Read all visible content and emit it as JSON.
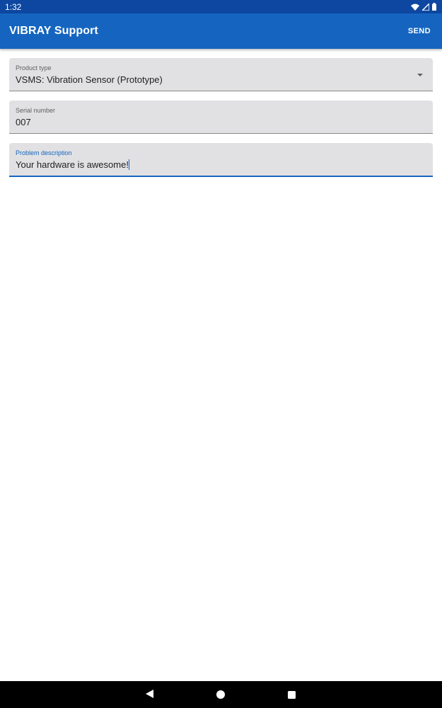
{
  "status_bar": {
    "time": "1:32",
    "icons": [
      "wifi-icon",
      "signal-icon",
      "battery-icon"
    ]
  },
  "app_bar": {
    "title": "VIBRAY Support",
    "send_label": "SEND"
  },
  "form": {
    "product_type": {
      "label": "Product type",
      "value": "VSMS: Vibration Sensor (Prototype)"
    },
    "serial_number": {
      "label": "Serial number",
      "value": "007"
    },
    "problem_description": {
      "label": "Problem description",
      "value": "Your hardware is awesome!"
    }
  },
  "nav_bar": {
    "icons": [
      "back-icon",
      "home-icon",
      "recents-icon"
    ]
  },
  "colors": {
    "status_bar": "#0d47a1",
    "app_bar": "#1565c0",
    "field_background": "#e1e1e3",
    "accent": "#1565c0"
  }
}
